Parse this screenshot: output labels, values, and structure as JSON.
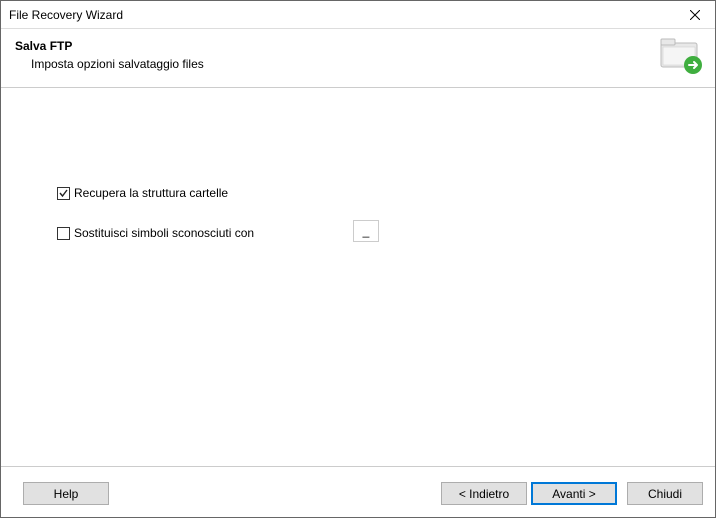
{
  "window": {
    "title": "File Recovery Wizard"
  },
  "header": {
    "title": "Salva FTP",
    "subtitle": "Imposta opzioni salvataggio files"
  },
  "options": {
    "recover_structure": {
      "label": "Recupera la struttura cartelle",
      "checked": true
    },
    "substitute_symbols": {
      "label": "Sostituisci simboli sconosciuti con",
      "checked": false,
      "value": "_"
    }
  },
  "buttons": {
    "help": "Help",
    "back": "< Indietro",
    "next": "Avanti >",
    "close": "Chiudi"
  }
}
